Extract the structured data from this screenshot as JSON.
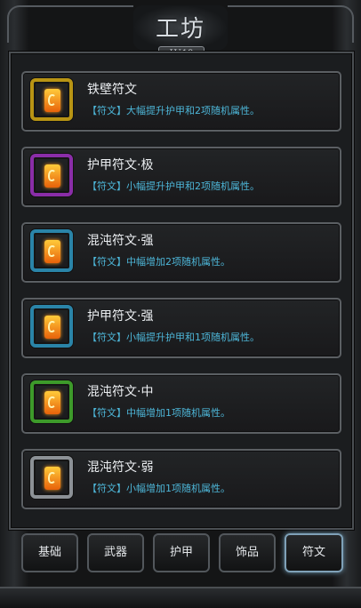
{
  "header": {
    "title": "工坊",
    "level": "LV.18"
  },
  "items": [
    {
      "name": "铁壁符文",
      "desc": "【符文】大幅提升护甲和2项随机属性。",
      "slot_color": "#b89414"
    },
    {
      "name": "护甲符文·极",
      "desc": "【符文】小幅提升护甲和2项随机属性。",
      "slot_color": "#8a2da8"
    },
    {
      "name": "混沌符文·强",
      "desc": "【符文】中幅增加2项随机属性。",
      "slot_color": "#2a84a8"
    },
    {
      "name": "护甲符文·强",
      "desc": "【符文】小幅提升护甲和1项随机属性。",
      "slot_color": "#2a84a8"
    },
    {
      "name": "混沌符文·中",
      "desc": "【符文】中幅增加1项随机属性。",
      "slot_color": "#3d9a2a"
    },
    {
      "name": "混沌符文·弱",
      "desc": "【符文】小幅增加1项随机属性。",
      "slot_color": "#8c9196"
    }
  ],
  "tabs": [
    {
      "label": "基础",
      "active": false
    },
    {
      "label": "武器",
      "active": false
    },
    {
      "label": "护甲",
      "active": false
    },
    {
      "label": "饰品",
      "active": false
    },
    {
      "label": "符文",
      "active": true
    }
  ]
}
